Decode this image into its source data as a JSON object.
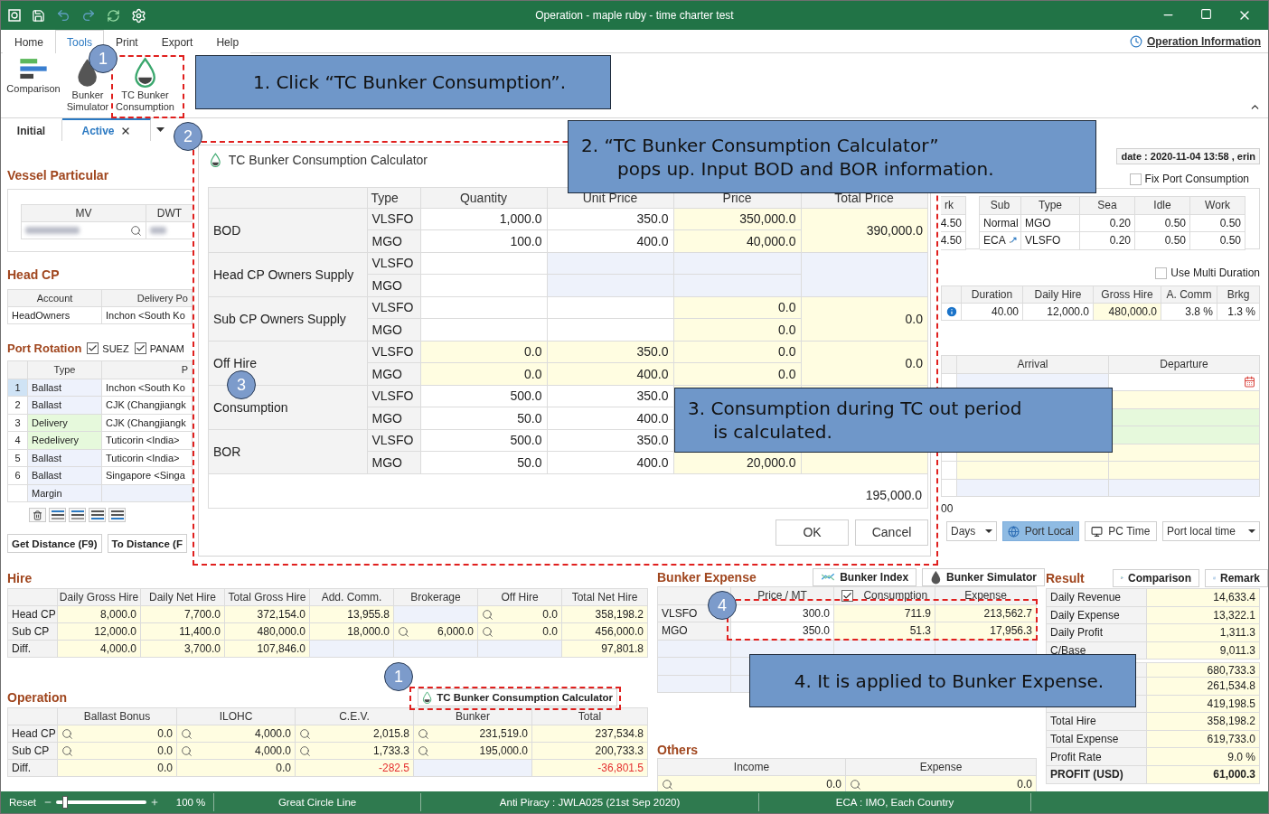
{
  "window": {
    "title": "Operation - maple ruby - time charter test"
  },
  "menu": [
    {
      "label": "Home",
      "selected": false
    },
    {
      "label": "Tools",
      "selected": true
    },
    {
      "label": "Print",
      "selected": false
    },
    {
      "label": "Export",
      "selected": false
    },
    {
      "label": "Help",
      "selected": false
    }
  ],
  "info_link": "Operation Information",
  "ribbon": [
    {
      "label": "Comparison",
      "kind": "comparison"
    },
    {
      "label": "Bunker Simulator",
      "kind": "drop"
    },
    {
      "label": "TC Bunker Consumption",
      "kind": "tc"
    }
  ],
  "doc_tabs": [
    {
      "label": "Initial",
      "selected": false,
      "closable": false
    },
    {
      "label": "Active",
      "selected": true,
      "closable": true
    }
  ],
  "vessel_particular": {
    "title": "Vessel Particular",
    "columns": [
      "MV",
      "DWT"
    ]
  },
  "head_cp": {
    "title": "Head CP",
    "columns": [
      "Account",
      "Delivery Po"
    ],
    "rows": [
      [
        "HeadOwners",
        "Inchon <South Ko"
      ]
    ]
  },
  "port_rotation": {
    "title": "Port Rotation",
    "options": [
      {
        "label": "SUEZ",
        "checked": true
      },
      {
        "label": "PANAM",
        "checked": true
      }
    ],
    "columns": [
      "Type",
      "P"
    ],
    "rows": [
      {
        "no": "1",
        "type": "Ballast",
        "port": "Inchon <South Ko",
        "selected": true,
        "color": "#eef2fc"
      },
      {
        "no": "2",
        "type": "Ballast",
        "port": "CJK (Changjiangk",
        "selected": false,
        "color": "#eef2fc"
      },
      {
        "no": "3",
        "type": "Delivery",
        "port": "CJK (Changjiangk",
        "selected": false,
        "color": "#e6f9dc"
      },
      {
        "no": "4",
        "type": "Redelivery",
        "port": "Tuticorin <India>",
        "selected": false,
        "color": "#e6f9dc"
      },
      {
        "no": "5",
        "type": "Ballast",
        "port": "Tuticorin <India>",
        "selected": false,
        "color": "#eef2fc"
      },
      {
        "no": "6",
        "type": "Ballast",
        "port": "Singapore <Singa",
        "selected": false,
        "color": "#eef2fc"
      },
      {
        "type": "Margin",
        "selected": false,
        "color": "#eef2fc"
      }
    ]
  },
  "distance_buttons": [
    "Get Distance (F9)",
    "To Distance (F"
  ],
  "dialog": {
    "title": "TC Bunker Consumption Calculator",
    "columns": [
      "Type",
      "Quantity",
      "Unit Price",
      "Price",
      "Total Price"
    ],
    "groups": [
      {
        "name": "BOD",
        "kind": "purchase",
        "total": "390,000.0",
        "lines": [
          {
            "type": "VLSFO",
            "quantity": "1,000.0",
            "unit_price": "350.0",
            "price": "350,000.0"
          },
          {
            "type": "MGO",
            "quantity": "100.0",
            "unit_price": "400.0",
            "price": "40,000.0"
          }
        ]
      },
      {
        "name": "Head CP Owners Supply",
        "kind": "owners",
        "lines": [
          {
            "type": "VLSFO"
          },
          {
            "type": "MGO"
          }
        ]
      },
      {
        "name": "Sub CP Owners Supply",
        "kind": "purchase",
        "total": "0.0",
        "lines": [
          {
            "type": "VLSFO",
            "price": "0.0"
          },
          {
            "type": "MGO",
            "price": "0.0"
          }
        ]
      },
      {
        "name": "Off Hire",
        "kind": "off_hire",
        "total": "0.0",
        "lines": [
          {
            "type": "VLSFO",
            "quantity": "0.0",
            "unit_price": "350.0",
            "price": "0.0"
          },
          {
            "type": "MGO",
            "quantity": "0.0",
            "unit_price": "400.0",
            "price": "0.0"
          }
        ]
      },
      {
        "name": "Consumption",
        "kind": "purchase",
        "lines": [
          {
            "type": "VLSFO",
            "quantity": "500.0",
            "unit_price": "350.0"
          },
          {
            "type": "MGO",
            "quantity": "50.0",
            "unit_price": "400.0"
          }
        ]
      },
      {
        "name": "BOR",
        "kind": "purchase",
        "lines": [
          {
            "type": "VLSFO",
            "quantity": "500.0",
            "unit_price": "350.0"
          },
          {
            "type": "MGO",
            "quantity": "50.0",
            "unit_price": "400.0",
            "price": "20,000.0"
          }
        ]
      }
    ],
    "footer_total": "195,000.0",
    "buttons": [
      "OK",
      "Cancel"
    ]
  },
  "update_info": "date : 2020-11-04 13:58 , erin",
  "fix_port_consumption": {
    "label": "Fix Port Consumption",
    "checked": false
  },
  "speed_partial": {
    "column": "rk",
    "rows": [
      "4.50",
      "4.50"
    ]
  },
  "consumption_table": {
    "columns": [
      "Sub",
      "Type",
      "Sea",
      "Idle",
      "Work"
    ],
    "rows": [
      {
        "kind": "normal",
        "cells": [
          "Normal",
          "MGO",
          "0.20",
          "0.50",
          "0.50"
        ]
      },
      {
        "kind": "eca",
        "cells": [
          "ECA",
          "VLSFO",
          "0.20",
          "0.50",
          "0.50"
        ]
      }
    ]
  },
  "multi_duration": {
    "label": "Use Multi Duration",
    "checked": false
  },
  "duration_table": {
    "columns": [
      "Duration",
      "Daily Hire",
      "Gross Hire",
      "A. Comm",
      "Brkg"
    ],
    "rows": [
      [
        "40.00",
        "12,000.0",
        "480,000.0",
        "3.8 %",
        "1.3 %"
      ]
    ]
  },
  "schedule": {
    "columns": [
      "Arrival",
      "Departure"
    ],
    "rows": [
      {
        "color": "#eef2fc"
      },
      {
        "color": "#fffde1"
      },
      {
        "color": "#e6f9dc"
      },
      {
        "color": "#e6f9dc"
      },
      {
        "color": "#fffde1"
      },
      {
        "color": "#fffde1"
      },
      {
        "color": "#eef2fc"
      }
    ]
  },
  "partial_value": "00",
  "time_controls": {
    "unit": "Days",
    "buttons": [
      {
        "label": "Port Local",
        "selected": true
      },
      {
        "label": "PC Time",
        "selected": false
      }
    ],
    "zone": "Port local time"
  },
  "hire": {
    "title": "Hire",
    "columns": [
      "Daily Gross Hire",
      "Daily Net Hire",
      "Total Gross Hire",
      "Add. Comm.",
      "Brokerage",
      "Off Hire",
      "Total Net Hire"
    ],
    "rows": [
      {
        "label": "Head CP",
        "cells": [
          "8,000.0",
          "7,700.0",
          "372,154.0",
          "13,955.8",
          null,
          {
            "text": "0.0",
            "lookup": true
          },
          "358,198.2"
        ]
      },
      {
        "label": "Sub CP",
        "cells": [
          "12,000.0",
          "11,400.0",
          "480,000.0",
          "18,000.0",
          {
            "text": "6,000.0",
            "lookup": true
          },
          {
            "text": "0.0",
            "lookup": true
          },
          "456,000.0"
        ]
      },
      {
        "label": "Diff.",
        "cells": [
          "4,000.0",
          "3,700.0",
          "107,846.0",
          null,
          null,
          null,
          "97,801.8"
        ]
      }
    ]
  },
  "operation": {
    "title": "Operation",
    "calculator_button": "TC Bunker Consumption Calculator",
    "columns": [
      "Ballast Bonus",
      "ILOHC",
      "C.E.V.",
      "Bunker",
      "Total"
    ],
    "rows": [
      {
        "label": "Head CP",
        "cells": [
          {
            "text": "0.0",
            "lookup": true
          },
          {
            "text": "4,000.0",
            "lookup": true
          },
          {
            "text": "2,015.8",
            "lookup": true
          },
          {
            "text": "231,519.0",
            "lookup": true
          },
          "237,534.8"
        ]
      },
      {
        "label": "Sub CP",
        "cells": [
          {
            "text": "0.0",
            "lookup": true
          },
          {
            "text": "4,000.0",
            "lookup": true
          },
          {
            "text": "1,733.3",
            "lookup": true
          },
          {
            "text": "195,000.0",
            "lookup": true
          },
          "200,733.3"
        ]
      },
      {
        "label": "Diff.",
        "cells": [
          "0.0",
          "0.0",
          {
            "text": "-282.5",
            "negative": true
          },
          null,
          {
            "text": "-36,801.5",
            "negative": true
          }
        ]
      }
    ]
  },
  "bunker_expense": {
    "title": "Bunker Expense",
    "buttons": [
      {
        "label": "Bunker Index",
        "kind": "index"
      },
      {
        "label": "Bunker Simulator",
        "kind": "drop"
      }
    ],
    "columns": [
      "Price / MT",
      "Consumption",
      "Expense"
    ],
    "consumption_checked": true,
    "rows": [
      {
        "label": "VLSFO",
        "cells": [
          "300.0",
          "711.9",
          "213,562.7"
        ]
      },
      {
        "label": "MGO",
        "cells": [
          "350.0",
          "51.3",
          "17,956.3"
        ]
      },
      {
        "label": null,
        "cells": [
          null,
          null,
          null
        ]
      },
      {
        "label": null,
        "cells": [
          null,
          null,
          null
        ]
      },
      {
        "label": null,
        "cells": [
          null,
          null,
          null
        ]
      }
    ]
  },
  "others": {
    "title": "Others",
    "columns": [
      "Income",
      "Expense"
    ],
    "rows": [
      {
        "cells": [
          {
            "text": "0.0",
            "lookup": true
          },
          {
            "text": "0.0",
            "lookup": true
          }
        ]
      }
    ]
  },
  "result": {
    "title": "Result",
    "buttons": [
      {
        "label": "Comparison",
        "kind": "comparison"
      },
      {
        "label": "Remark",
        "kind": "edit"
      }
    ],
    "rows": [
      {
        "label": "Daily Revenue",
        "value": "14,633.4",
        "strong": false,
        "gap_before": false
      },
      {
        "label": "Daily Expense",
        "value": "13,322.1",
        "strong": false,
        "gap_before": false
      },
      {
        "label": "Daily Profit",
        "value": "1,311.3",
        "strong": false,
        "gap_before": false
      },
      {
        "label": "C/Base",
        "value": "9,011.3",
        "strong": false,
        "gap_before": false
      },
      {
        "value": "680,733.3",
        "strong": false,
        "gap_before": true
      },
      {
        "value": "261,534.8",
        "strong": false,
        "gap_before": false
      },
      {
        "value": "419,198.5",
        "strong": false,
        "gap_before": false
      },
      {
        "label": "Total Hire",
        "value": "358,198.2",
        "strong": false,
        "gap_before": false
      },
      {
        "label": "Total Expense",
        "value": "619,733.0",
        "strong": false,
        "gap_before": false
      },
      {
        "label": "Profit Rate",
        "value": "9.0 %",
        "strong": false,
        "gap_before": false
      },
      {
        "label": "PROFIT (USD)",
        "value": "61,000.3",
        "strong": true,
        "gap_before": false
      }
    ]
  },
  "status_bar": {
    "reset": "Reset",
    "zoom": {
      "level": 0.1
    },
    "zoom_text": "100 %",
    "items": [
      "Great Circle Line",
      "Anti Piracy : JWLA025 (21st Sep 2020)",
      "ECA : IMO, Each Country"
    ]
  },
  "callouts": [
    {
      "lines": [
        "1. Click “TC Bunker Consumption”."
      ]
    },
    {
      "lines": [
        "2. “TC Bunker Consumption Calculator”",
        "pops up. Input BOD and BOR information."
      ]
    },
    {
      "lines": [
        "3. Consumption during TC out period",
        "is calculated."
      ]
    },
    {
      "lines": [
        "4. It is applied to Bunker Expense."
      ]
    }
  ],
  "markers": [
    "1",
    "2",
    "3",
    "4",
    "1"
  ]
}
